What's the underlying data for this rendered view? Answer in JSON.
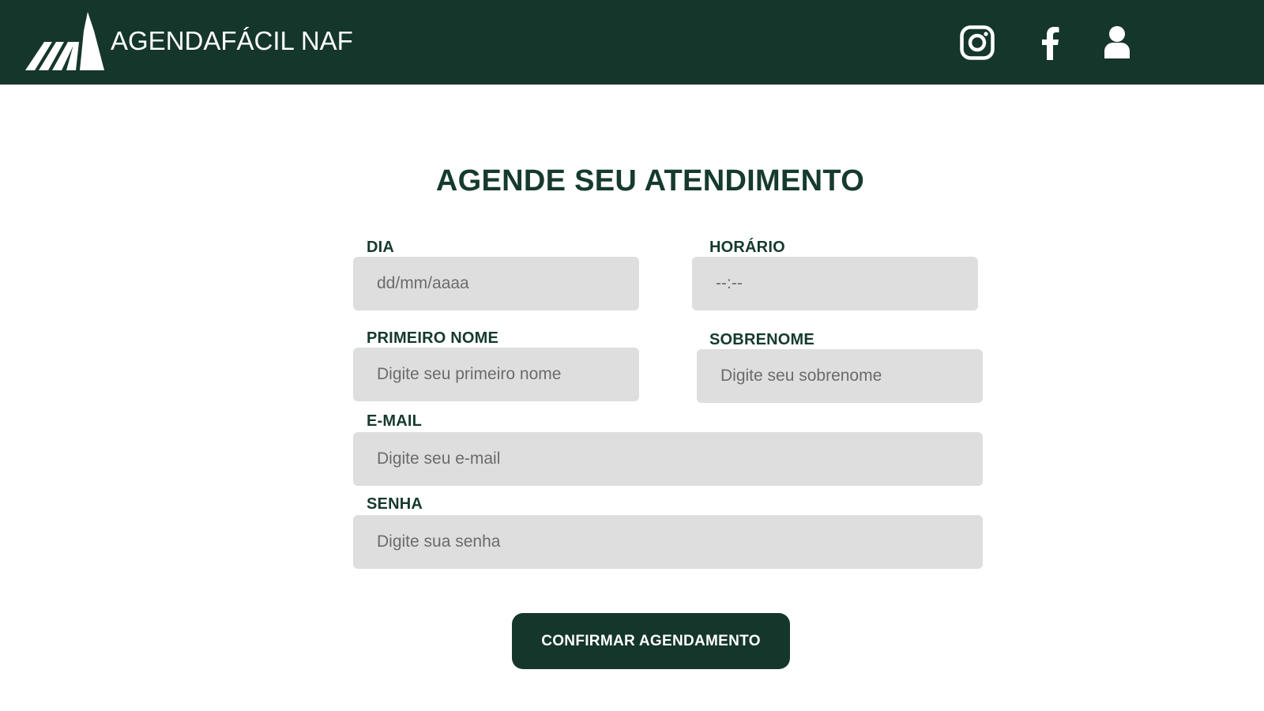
{
  "app": {
    "brand": "AGENDAFÁCIL NAF",
    "brand_color": "#15362b",
    "icons": [
      "logo-mountain-icon",
      "instagram-icon",
      "facebook-icon",
      "user-icon"
    ]
  },
  "form": {
    "title": "AGENDE SEU ATENDIMENTO",
    "fields": {
      "dia": {
        "label": "DIA",
        "placeholder": "dd/mm/aaaa",
        "value": ""
      },
      "horario": {
        "label": "HORÁRIO",
        "placeholder": "--:--",
        "value": ""
      },
      "primeiro_nome": {
        "label": "PRIMEIRO NOME",
        "placeholder": "Digite seu primeiro nome",
        "value": ""
      },
      "sobrenome": {
        "label": "SOBRENOME",
        "placeholder": "Digite seu sobrenome",
        "value": ""
      },
      "email": {
        "label": "E-MAIL",
        "placeholder": "Digite seu e-mail",
        "value": ""
      },
      "senha": {
        "label": "SENHA",
        "placeholder": "Digite sua senha",
        "value": ""
      }
    },
    "submit_label": "CONFIRMAR AGENDAMENTO",
    "field_bg_color": "#dedede"
  }
}
